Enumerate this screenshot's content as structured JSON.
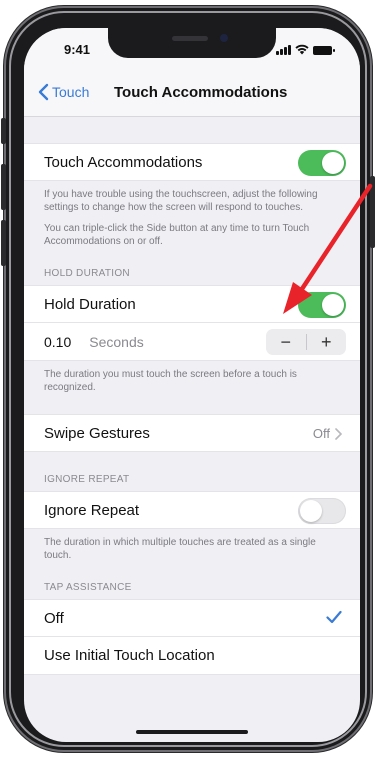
{
  "status_bar": {
    "time": "9:41"
  },
  "nav": {
    "back_label": "Touch",
    "title": "Touch Accommodations"
  },
  "touch_accommodations": {
    "label": "Touch Accommodations",
    "enabled": true,
    "footnote_1": "If you have trouble using the touchscreen, adjust the following settings to change how the screen will respond to touches.",
    "footnote_2": "You can triple-click the Side button at any time to turn Touch Accommodations on or off."
  },
  "hold_duration": {
    "header": "HOLD DURATION",
    "label": "Hold Duration",
    "enabled": true,
    "value": "0.10",
    "unit": "Seconds",
    "minus": "−",
    "plus": "+",
    "footnote": "The duration you must touch the screen before a touch is recognized."
  },
  "swipe_gestures": {
    "label": "Swipe Gestures",
    "value": "Off"
  },
  "ignore_repeat": {
    "header": "IGNORE REPEAT",
    "label": "Ignore Repeat",
    "enabled": false,
    "footnote": "The duration in which multiple touches are treated as a single touch."
  },
  "tap_assistance": {
    "header": "TAP ASSISTANCE",
    "options": [
      {
        "label": "Off",
        "selected": true
      },
      {
        "label": "Use Initial Touch Location",
        "selected": false
      }
    ]
  },
  "colors": {
    "accent": "#3a7bd5",
    "toggle_on": "#4cbb5a",
    "annotation_arrow": "#e8232a"
  },
  "icons": [
    "chevron-left-icon",
    "chevron-right-icon",
    "checkmark-icon",
    "signal-icon",
    "wifi-icon",
    "battery-icon",
    "red-arrow-annotation"
  ]
}
